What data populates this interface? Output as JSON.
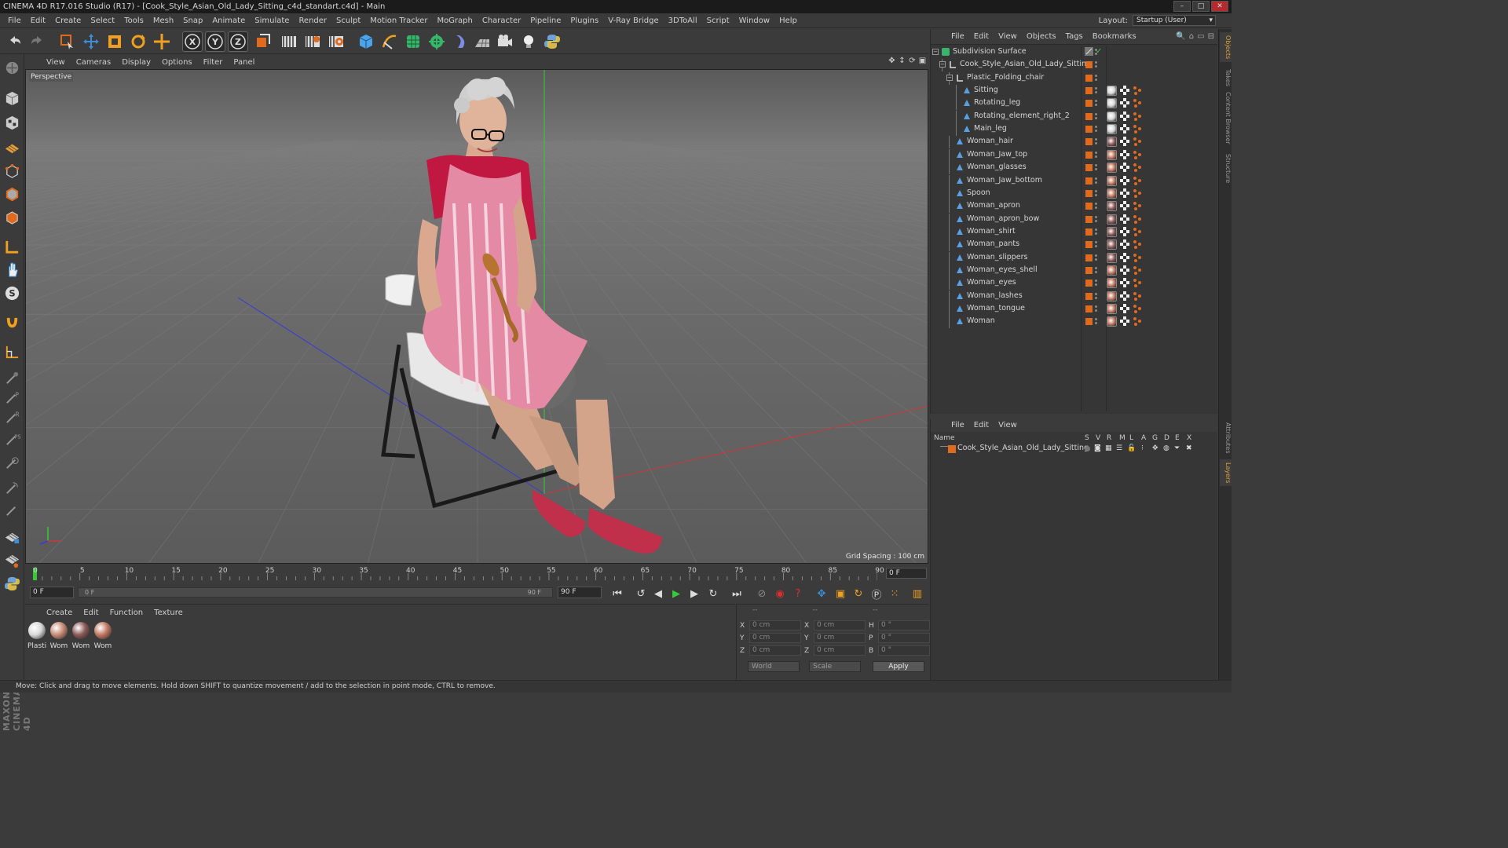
{
  "window": {
    "title": "CINEMA 4D R17.016 Studio (R17) - [Cook_Style_Asian_Old_Lady_Sitting_c4d_standart.c4d] - Main"
  },
  "menubar": {
    "items": [
      "File",
      "Edit",
      "Create",
      "Select",
      "Tools",
      "Mesh",
      "Snap",
      "Animate",
      "Simulate",
      "Render",
      "Sculpt",
      "Motion Tracker",
      "MoGraph",
      "Character",
      "Pipeline",
      "Plugins",
      "V-Ray Bridge",
      "3DToAll",
      "Script",
      "Window",
      "Help"
    ],
    "layout_label": "Layout:",
    "layout_value": "Startup (User)"
  },
  "toolbar": {
    "axis_x": "X",
    "axis_y": "Y",
    "axis_z": "Z"
  },
  "viewport": {
    "menu": [
      "View",
      "Cameras",
      "Display",
      "Options",
      "Filter",
      "Panel"
    ],
    "label": "Perspective",
    "grid_spacing": "Grid Spacing : 100 cm"
  },
  "timeline": {
    "ticks": [
      "0",
      "5",
      "10",
      "15",
      "20",
      "25",
      "30",
      "35",
      "40",
      "45",
      "50",
      "55",
      "60",
      "65",
      "70",
      "75",
      "80",
      "85",
      "90"
    ],
    "current_frame_field": "0 F"
  },
  "transport": {
    "start_field": "0 F",
    "slider_start": "0 F",
    "slider_end": "90 F",
    "end_field": "90 F"
  },
  "materials": {
    "menu": [
      "Create",
      "Edit",
      "Function",
      "Texture"
    ],
    "items": [
      {
        "label": "Plasti",
        "color": "#d8d8d8"
      },
      {
        "label": "Wom",
        "color": "#c98a74"
      },
      {
        "label": "Wom",
        "color": "#8a5a56"
      },
      {
        "label": "Wom",
        "color": "#c07860"
      }
    ]
  },
  "coordinates": {
    "head": [
      "--",
      "--",
      "--"
    ],
    "rows": [
      {
        "a": "X",
        "av": "0 cm",
        "b": "X",
        "bv": "0 cm",
        "c": "H",
        "cv": "0 °"
      },
      {
        "a": "Y",
        "av": "0 cm",
        "b": "Y",
        "bv": "0 cm",
        "c": "P",
        "cv": "0 °"
      },
      {
        "a": "Z",
        "av": "0 cm",
        "b": "Z",
        "bv": "0 cm",
        "c": "B",
        "cv": "0 °"
      }
    ],
    "mode_dropdown": "World",
    "scale_dropdown": "Scale",
    "apply": "Apply"
  },
  "status": {
    "text": "Move: Click and drag to move elements. Hold down SHIFT to quantize movement / add to the selection in point mode, CTRL to remove."
  },
  "objects": {
    "menu": [
      "File",
      "Edit",
      "View",
      "Objects",
      "Tags",
      "Bookmarks"
    ],
    "rows": [
      {
        "name": "Subdivision Surface",
        "depth": 0,
        "kind": "subdiv"
      },
      {
        "name": "Cook_Style_Asian_Old_Lady_Sitting",
        "depth": 1,
        "kind": "null"
      },
      {
        "name": "Plastic_Folding_chair",
        "depth": 2,
        "kind": "null"
      },
      {
        "name": "Sitting",
        "depth": 3,
        "kind": "poly",
        "mat": "#d8d8d8"
      },
      {
        "name": "Rotating_leg",
        "depth": 3,
        "kind": "poly",
        "mat": "#d8d8d8"
      },
      {
        "name": "Rotating_element_right_2",
        "depth": 3,
        "kind": "poly",
        "mat": "#d8d8d8"
      },
      {
        "name": "Main_leg",
        "depth": 3,
        "kind": "poly",
        "mat": "#d8d8d8"
      },
      {
        "name": "Woman_hair",
        "depth": 2,
        "kind": "poly",
        "mat": "#8a5a56"
      },
      {
        "name": "Woman_Jaw_top",
        "depth": 2,
        "kind": "poly",
        "mat": "#c07860"
      },
      {
        "name": "Woman_glasses",
        "depth": 2,
        "kind": "poly",
        "mat": "#c07860"
      },
      {
        "name": "Woman_Jaw_bottom",
        "depth": 2,
        "kind": "poly",
        "mat": "#c07860"
      },
      {
        "name": "Spoon",
        "depth": 2,
        "kind": "poly",
        "mat": "#c07860"
      },
      {
        "name": "Woman_apron",
        "depth": 2,
        "kind": "poly",
        "mat": "#8a5a56"
      },
      {
        "name": "Woman_apron_bow",
        "depth": 2,
        "kind": "poly",
        "mat": "#8a5a56"
      },
      {
        "name": "Woman_shirt",
        "depth": 2,
        "kind": "poly",
        "mat": "#8a5a56"
      },
      {
        "name": "Woman_pants",
        "depth": 2,
        "kind": "poly",
        "mat": "#8a5a56"
      },
      {
        "name": "Woman_slippers",
        "depth": 2,
        "kind": "poly",
        "mat": "#8a5a56"
      },
      {
        "name": "Woman_eyes_shell",
        "depth": 2,
        "kind": "poly",
        "mat": "#c07860"
      },
      {
        "name": "Woman_eyes",
        "depth": 2,
        "kind": "poly",
        "mat": "#c07860"
      },
      {
        "name": "Woman_lashes",
        "depth": 2,
        "kind": "poly",
        "mat": "#c07860"
      },
      {
        "name": "Woman_tongue",
        "depth": 2,
        "kind": "poly",
        "mat": "#c07860"
      },
      {
        "name": "Woman",
        "depth": 2,
        "kind": "poly",
        "mat": "#c07860"
      }
    ]
  },
  "layers": {
    "menu": [
      "File",
      "Edit",
      "View"
    ],
    "columns": [
      "Name",
      "S",
      "V",
      "R",
      "M",
      "L",
      "A",
      "G",
      "D",
      "E",
      "X"
    ],
    "row_name": "Cook_Style_Asian_Old_Lady_Sitting",
    "row_color": "#e06a1d"
  },
  "side_tabs": [
    "Objects",
    "Takes",
    "Content Browser",
    "Structure",
    "Attributes",
    "Layers"
  ],
  "brand": "MAXON CINEMA 4D",
  "colors": {
    "accent_orange": "#e06a1d",
    "active_tab": "#e3a03a"
  }
}
